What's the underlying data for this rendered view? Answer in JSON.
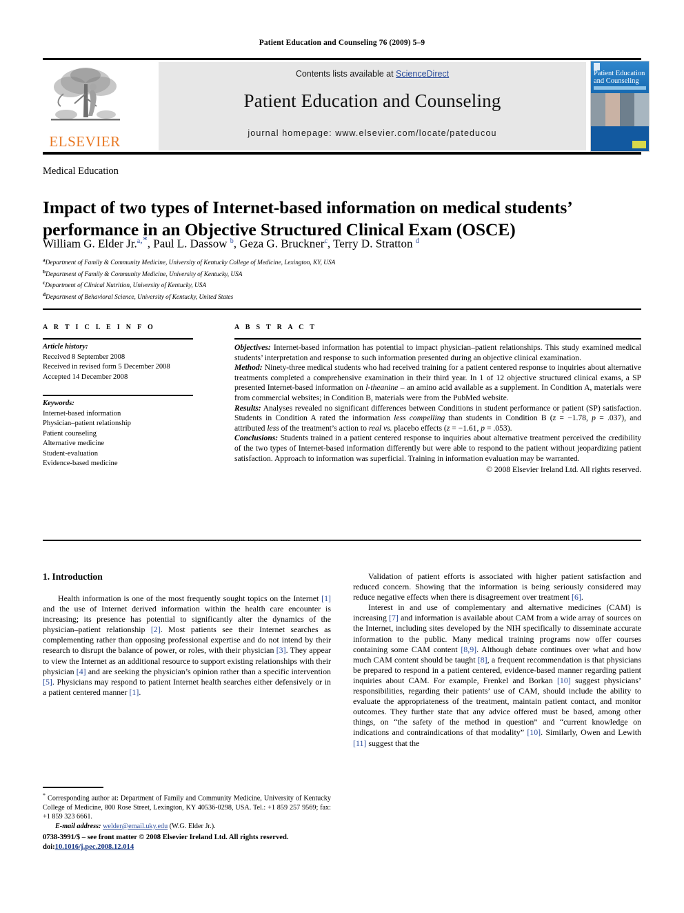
{
  "header": {
    "running_head": "Patient Education and Counseling 76 (2009) 5–9"
  },
  "masthead": {
    "contents_prefix": "Contents lists available at ",
    "sciencedirect": "ScienceDirect",
    "journal_title": "Patient Education and Counseling",
    "homepage": "journal homepage: www.elsevier.com/locate/pateducou",
    "publisher_wordmark": "ELSEVIER",
    "cover": {
      "title_line1": "Patient Education",
      "title_line2": "and Counseling"
    }
  },
  "article": {
    "section_kind": "Medical Education",
    "title": "Impact of two types of Internet-based information on medical students’ performance in an Objective Structured Clinical Exam (OSCE)",
    "authors_html": "William G. Elder Jr.<sup class=\"sup\">a</sup><sup class=\"sup-star\">,*</sup>, Paul L. Dassow <sup class=\"sup\">b</sup>, Geza G. Bruckner<sup class=\"sup\">c</sup>, Terry D. Stratton <sup class=\"sup\">d</sup>",
    "affiliations": [
      {
        "mark": "a",
        "text": "Department of Family & Community Medicine, University of Kentucky College of Medicine, Lexington, KY, USA"
      },
      {
        "mark": "b",
        "text": "Department of Family & Community Medicine, University of Kentucky, USA"
      },
      {
        "mark": "c",
        "text": "Department of Clinical Nutrition, University of Kentucky, USA"
      },
      {
        "mark": "d",
        "text": "Department of Behavioral Science, University of Kentucky, United States"
      }
    ]
  },
  "article_info": {
    "heading": "A R T I C L E  I N F O",
    "history_label": "Article history:",
    "history": [
      "Received 8 September 2008",
      "Received in revised form 5 December 2008",
      "Accepted 14 December 2008"
    ],
    "keywords_label": "Keywords:",
    "keywords": [
      "Internet-based information",
      "Physician–patient relationship",
      "Patient counseling",
      "Alternative medicine",
      "Student-evaluation",
      "Evidence-based medicine"
    ]
  },
  "abstract": {
    "heading": "A B S T R A C T",
    "objectives_label": "Objectives:",
    "objectives_text": " Internet-based information has potential to impact physician–patient relationships. This study examined medical students’ interpretation and response to such information presented during an objective clinical examination.",
    "method_label": "Method:",
    "method_html": " Ninety-three medical students who had received training for a patient centered response to inquiries about alternative treatments completed a comprehensive examination in their third year. In 1 of 12 objective structured clinical exams, a SP presented Internet-based information on <span class=\"it\">l-theanine</span> – an amino acid available as a supplement. In Condition A, materials were from commercial websites; in Condition B, materials were from the PubMed website.",
    "results_label": "Results:",
    "results_html": " Analyses revealed no significant differences between Conditions in student performance or patient (SP) satisfaction. Students in Condition A rated the information <span class=\"it\">less compelling</span> than students in Condition B (<span class=\"it\">z</span> = −1.78, <span class=\"it\">p</span> = .037), and attributed <span class=\"it\">less</span> of the treatment’s action to <span class=\"it\">real vs.</span> placebo effects (<span class=\"it\">z</span> = −1.61, <span class=\"it\">p</span> = .053).",
    "conclusions_label": "Conclusions:",
    "conclusions_text": " Students trained in a patient centered response to inquiries about alternative treatment perceived the credibility of the two types of Internet-based information differently but were able to respond to the patient without jeopardizing patient satisfaction. Approach to information was superficial. Training in information evaluation may be warranted.",
    "copyright": "© 2008 Elsevier Ireland Ltd. All rights reserved."
  },
  "body": {
    "section_heading": "1. Introduction",
    "left_paragraphs_html": [
      "Health information is one of the most frequently sought topics on the Internet <span class=\"ref\">[1]</span> and the use of Internet derived information within the health care encounter is increasing; its presence has potential to significantly alter the dynamics of the physician–patient relationship <span class=\"ref\">[2]</span>. Most patients see their Internet searches as complementing rather than opposing professional expertise and do not intend by their research to disrupt the balance of power, or roles, with their physician <span class=\"ref\">[3]</span>. They appear to view the Internet as an additional resource to support existing relationships with their physician <span class=\"ref\">[4]</span> and are seeking the physician’s opinion rather than a specific intervention <span class=\"ref\">[5]</span>. Physicians may respond to patient Internet health searches either defensively or in a patient centered manner <span class=\"ref\">[1]</span>."
    ],
    "right_paragraphs_html": [
      "Validation of patient efforts is associated with higher patient satisfaction and reduced concern. Showing that the information is being seriously considered may reduce negative effects when there is disagreement over treatment <span class=\"ref\">[6]</span>.",
      "Interest in and use of complementary and alternative medicines (CAM) is increasing <span class=\"ref\">[7]</span> and information is available about CAM from a wide array of sources on the Internet, including sites developed by the NIH specifically to disseminate accurate information to the public. Many medical training programs now offer courses containing some CAM content <span class=\"ref\">[8,9]</span>. Although debate continues over what and how much CAM content should be taught <span class=\"ref\">[8]</span>, a frequent recommendation is that physicians be prepared to respond in a patient centered, evidence-based manner regarding patient inquiries about CAM. For example, Frenkel and Borkan <span class=\"ref\">[10]</span> suggest physicians’ responsibilities, regarding their patients’ use of CAM, should include the ability to evaluate the appropriateness of the treatment, maintain patient contact, and monitor outcomes. They further state that any advice offered must be based, among other things, on “the safety of the method in question” and “current knowledge on indications and contraindications of that modality” <span class=\"ref\">[10]</span>. Similarly, Owen and Lewith <span class=\"ref\">[11]</span> suggest that the"
    ]
  },
  "footnotes": {
    "corresponding_html": "<span class=\"star\">*</span> Corresponding author at: Department of Family and Community Medicine, University of Kentucky College of Medicine, 800 Rose Street, Lexington, KY 40536-0298, USA. Tel.: +1 859 257 9569; fax: +1 859 323 6661.",
    "email_label": "E-mail address:",
    "email": "welder@email.uky.edu",
    "email_suffix": " (W.G. Elder Jr.)."
  },
  "imprint": {
    "line1": "0738-3991/$ – see front matter © 2008 Elsevier Ireland Ltd. All rights reserved.",
    "doi_prefix": "doi:",
    "doi": "10.1016/j.pec.2008.12.014"
  },
  "colors": {
    "link_blue": "#2b4c9b",
    "elsevier_orange": "#e87722",
    "band_gray": "#e7e7e7",
    "cover_blue": "#1669b2"
  }
}
